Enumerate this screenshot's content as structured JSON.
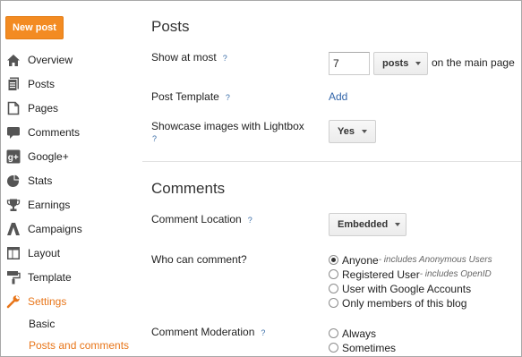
{
  "sidebar": {
    "new_post": "New post",
    "items": [
      {
        "label": "Overview",
        "icon": "home-icon"
      },
      {
        "label": "Posts",
        "icon": "posts-icon"
      },
      {
        "label": "Pages",
        "icon": "pages-icon"
      },
      {
        "label": "Comments",
        "icon": "comment-icon"
      },
      {
        "label": "Google+",
        "icon": "google-plus-icon"
      },
      {
        "label": "Stats",
        "icon": "pie-chart-icon"
      },
      {
        "label": "Earnings",
        "icon": "trophy-icon"
      },
      {
        "label": "Campaigns",
        "icon": "campaigns-icon"
      },
      {
        "label": "Layout",
        "icon": "layout-icon"
      },
      {
        "label": "Template",
        "icon": "paint-roller-icon"
      },
      {
        "label": "Settings",
        "icon": "wrench-icon"
      }
    ],
    "sub_items": [
      "Basic",
      "Posts and comments"
    ],
    "active_color": "#e8761a"
  },
  "posts": {
    "title": "Posts",
    "show_at_most": {
      "label": "Show at most",
      "help": "?",
      "value": "7",
      "unit": "posts",
      "suffix": "on the main page"
    },
    "post_template": {
      "label": "Post Template",
      "help": "?",
      "action": "Add"
    },
    "lightbox": {
      "label": "Showcase images with Lightbox",
      "help": "?",
      "value": "Yes"
    }
  },
  "comments": {
    "title": "Comments",
    "location": {
      "label": "Comment Location",
      "help": "?",
      "value": "Embedded"
    },
    "who": {
      "label": "Who can comment?",
      "options": [
        {
          "label": "Anyone",
          "note": " - includes Anonymous Users",
          "checked": true
        },
        {
          "label": "Registered User",
          "note": " - includes OpenID",
          "checked": false
        },
        {
          "label": "User with Google Accounts",
          "note": "",
          "checked": false
        },
        {
          "label": "Only members of this blog",
          "note": "",
          "checked": false
        }
      ]
    },
    "moderation": {
      "label": "Comment Moderation",
      "help": "?",
      "options": [
        {
          "label": "Always",
          "checked": false
        },
        {
          "label": "Sometimes",
          "checked": false
        }
      ]
    }
  },
  "colors": {
    "accent": "#f38b22",
    "link": "#3366aa",
    "icon": "#555555"
  }
}
